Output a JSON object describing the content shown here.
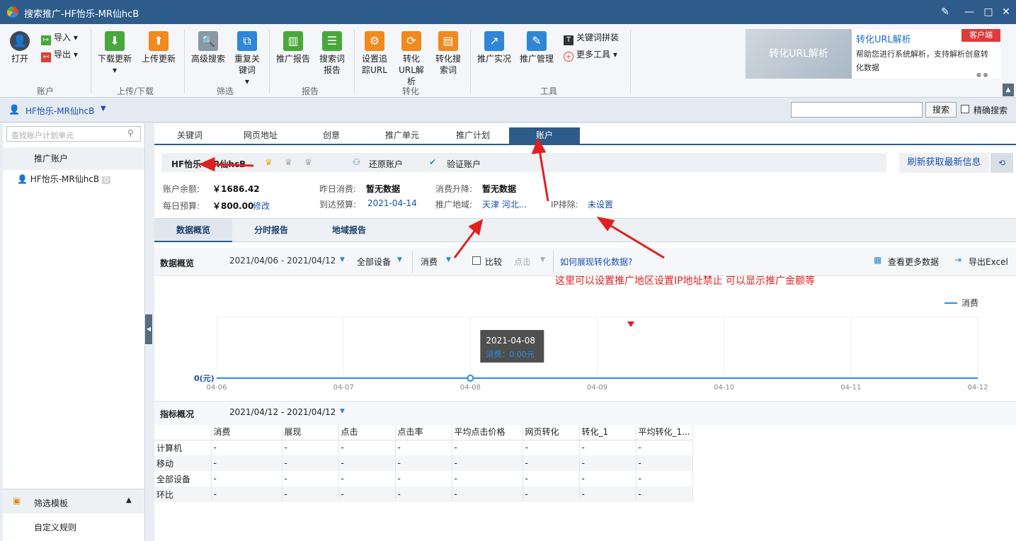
{
  "window": {
    "title": "搜索推广-HF怡乐-MR仙hcB"
  },
  "ribbon": {
    "open": "打开",
    "import": "导入",
    "export": "导出",
    "group_account": "账户",
    "download": "下载更新",
    "upload": "上传更新",
    "group_updown": "上传/下载",
    "adv_search": "高级搜索",
    "dup_kw": "重复关键词",
    "group_filter": "筛选",
    "promo_report": "推广报告",
    "search_report": "搜索词报告",
    "group_report": "报告",
    "track_url": "设置追踪URL",
    "conv_url": "转化URL解析",
    "conv_search": "转化搜索词",
    "group_conv": "转化",
    "live": "推广实况",
    "manage": "推广管理",
    "kw_combine": "关键词拼装",
    "more_tools": "更多工具",
    "group_tools": "工具"
  },
  "banner": {
    "img_text": "转化URL解析",
    "title": "转化URL解析",
    "desc": "帮助您进行系统解析，支持解析创意转化数据",
    "badge": "客户端"
  },
  "account_bar": {
    "name": "HF怡乐-MR仙hcB",
    "search_btn": "搜索",
    "exact": "精确搜索"
  },
  "sidebar": {
    "search_placeholder": "查找账户计划单元",
    "header": "推广账户",
    "account": "HF怡乐-MR仙hcB",
    "count": "0",
    "filter_tpl": "筛选模板",
    "custom_rule": "自定义规则"
  },
  "tabs": [
    "关键词",
    "网页地址",
    "创意",
    "推广单元",
    "推广计划",
    "账户"
  ],
  "account_info": {
    "name": "HF怡乐-MR仙hcB",
    "restore": "还原账户",
    "verify": "验证账户",
    "refresh": "刷新获取最新信息",
    "balance_lbl": "账户余额:",
    "balance": "￥1686.42",
    "yest_lbl": "昨日消费:",
    "yest": "暂无数据",
    "rise_lbl": "消费升降:",
    "rise": "暂无数据",
    "budget_lbl": "每日预算:",
    "budget": "￥800.00",
    "edit": "修改",
    "arrive_lbl": "到达预算:",
    "arrive": "2021-04-14",
    "region_lbl": "推广地域:",
    "region": "天津 河北...",
    "ip_lbl": "IP排除:",
    "ip": "未设置"
  },
  "subtabs": [
    "数据概览",
    "分时报告",
    "地域报告"
  ],
  "overview": {
    "label": "数据概览",
    "date_range": "2021/04/06 - 2021/04/12",
    "device": "全部设备",
    "metric": "消费",
    "compare": "比较",
    "click": "点击",
    "how_link": "如何展现转化数据?",
    "more_data": "查看更多数据",
    "export": "导出Excel",
    "annotation": "这里可以设置推广地区设置IP地址禁止  可以显示推广金额等"
  },
  "chart_data": {
    "type": "line",
    "x": [
      "04-06",
      "04-07",
      "04-08",
      "04-09",
      "04-10",
      "04-11",
      "04-12"
    ],
    "series": [
      {
        "name": "消费",
        "values": [
          0,
          0,
          0,
          0,
          0,
          0,
          0
        ]
      }
    ],
    "ylabel": "0(元)",
    "tooltip": {
      "date": "2021-04-08",
      "text": "消费：0.00元"
    },
    "color": "#2a8be6"
  },
  "kpi": {
    "label": "指标概况",
    "date_range": "2021/04/12 - 2021/04/12",
    "columns": [
      "",
      "消费",
      "展现",
      "点击",
      "点击率",
      "平均点击价格",
      "网页转化",
      "转化_1",
      "平均转化_1..."
    ],
    "rows": [
      [
        "计算机",
        "-",
        "-",
        "-",
        "-",
        "-",
        "-",
        "-",
        "-"
      ],
      [
        "移动",
        "-",
        "-",
        "-",
        "-",
        "-",
        "-",
        "-",
        "-"
      ],
      [
        "全部设备",
        "-",
        "-",
        "-",
        "-",
        "-",
        "-",
        "-",
        "-"
      ],
      [
        "环比",
        "-",
        "-",
        "-",
        "-",
        "-",
        "-",
        "-",
        "-"
      ]
    ]
  }
}
